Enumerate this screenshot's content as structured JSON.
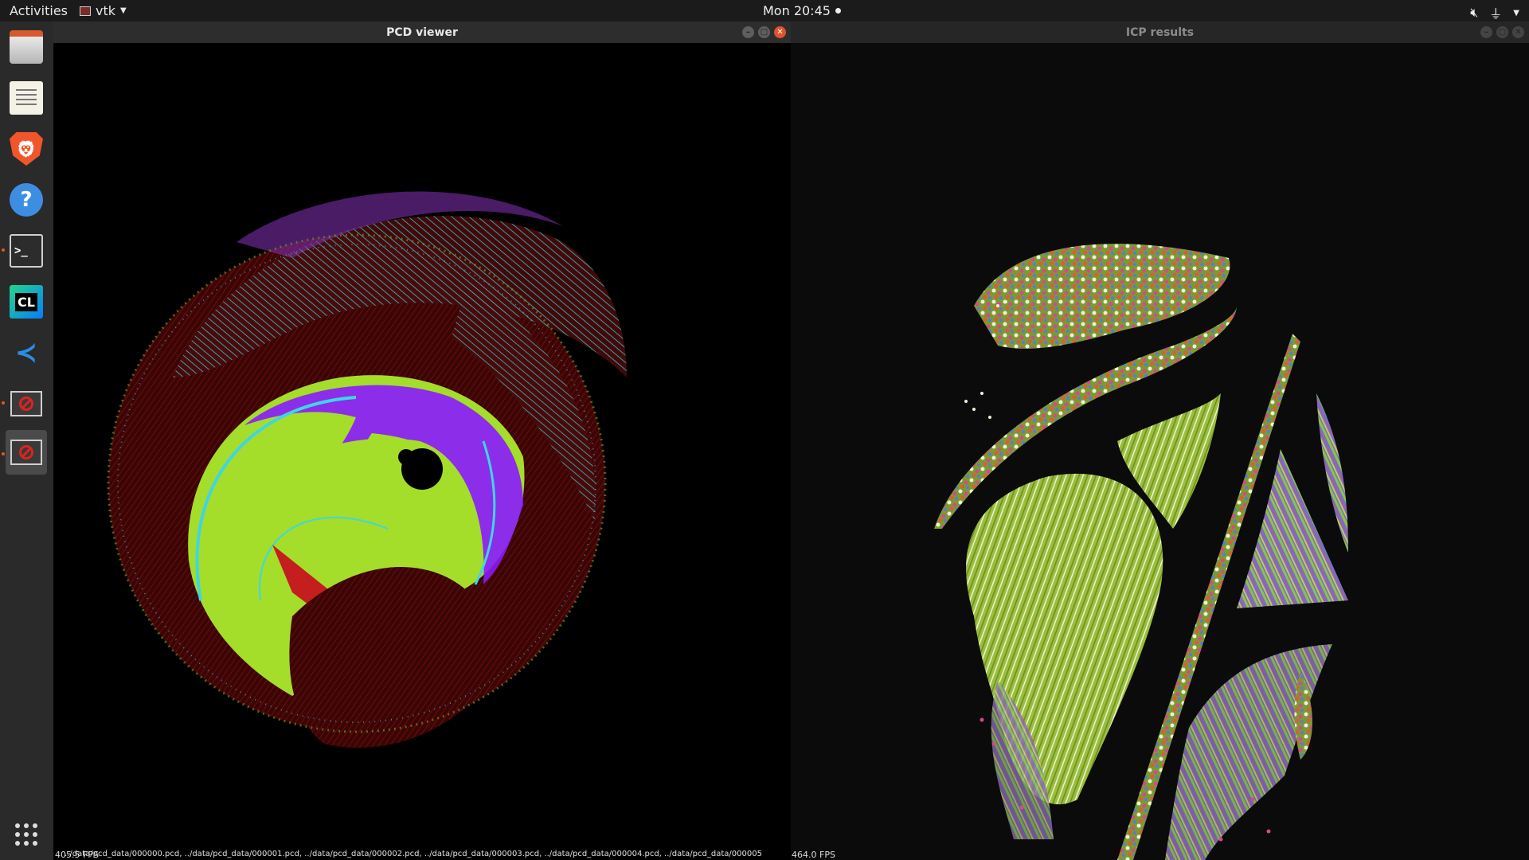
{
  "topbar": {
    "activities": "Activities",
    "app_name": "vtk",
    "clock": "Mon 20:45",
    "tray_icons": [
      "volume-muted-icon",
      "network-icon",
      "power-menu-icon"
    ]
  },
  "dock": {
    "items": [
      {
        "name": "files",
        "label": "Files"
      },
      {
        "name": "text-editor",
        "label": "Text Editor"
      },
      {
        "name": "brave-browser",
        "label": "Brave"
      },
      {
        "name": "help",
        "label": "?"
      },
      {
        "name": "terminal",
        "label": ">_"
      },
      {
        "name": "clion",
        "label": "CL"
      },
      {
        "name": "vscode",
        "label": "VS Code"
      },
      {
        "name": "vtk-window-1",
        "label": "vtk"
      },
      {
        "name": "vtk-window-2",
        "label": "vtk"
      },
      {
        "name": "show-applications",
        "label": "Show Applications"
      }
    ],
    "running_indicator_color": "#e95420"
  },
  "pcd_viewer": {
    "title": "PCD viewer",
    "fps": "405.5 FPS",
    "status": "../data/pcd_data/000000.pcd, ../data/pcd_data/000001.pcd, ../data/pcd_data/000002.pcd, ../data/pcd_data/000003.pcd, ../data/pcd_data/000004.pcd, ../data/pcd_data/000005",
    "colors": [
      "#a4dd2a",
      "#8a19ff",
      "#3ed6e6",
      "#5a0a0a",
      "#c41e1e"
    ]
  },
  "icp_results": {
    "title": "ICP results",
    "fps": "464.0 FPS",
    "colors": [
      "#9abf3a",
      "#f0f0d8",
      "#d34a8a",
      "#5a7ad8",
      "#e05a3a"
    ]
  }
}
